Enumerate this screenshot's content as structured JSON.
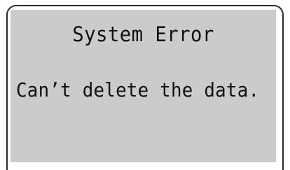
{
  "dialog": {
    "title": "System Error",
    "message": "Can’t delete the data."
  }
}
